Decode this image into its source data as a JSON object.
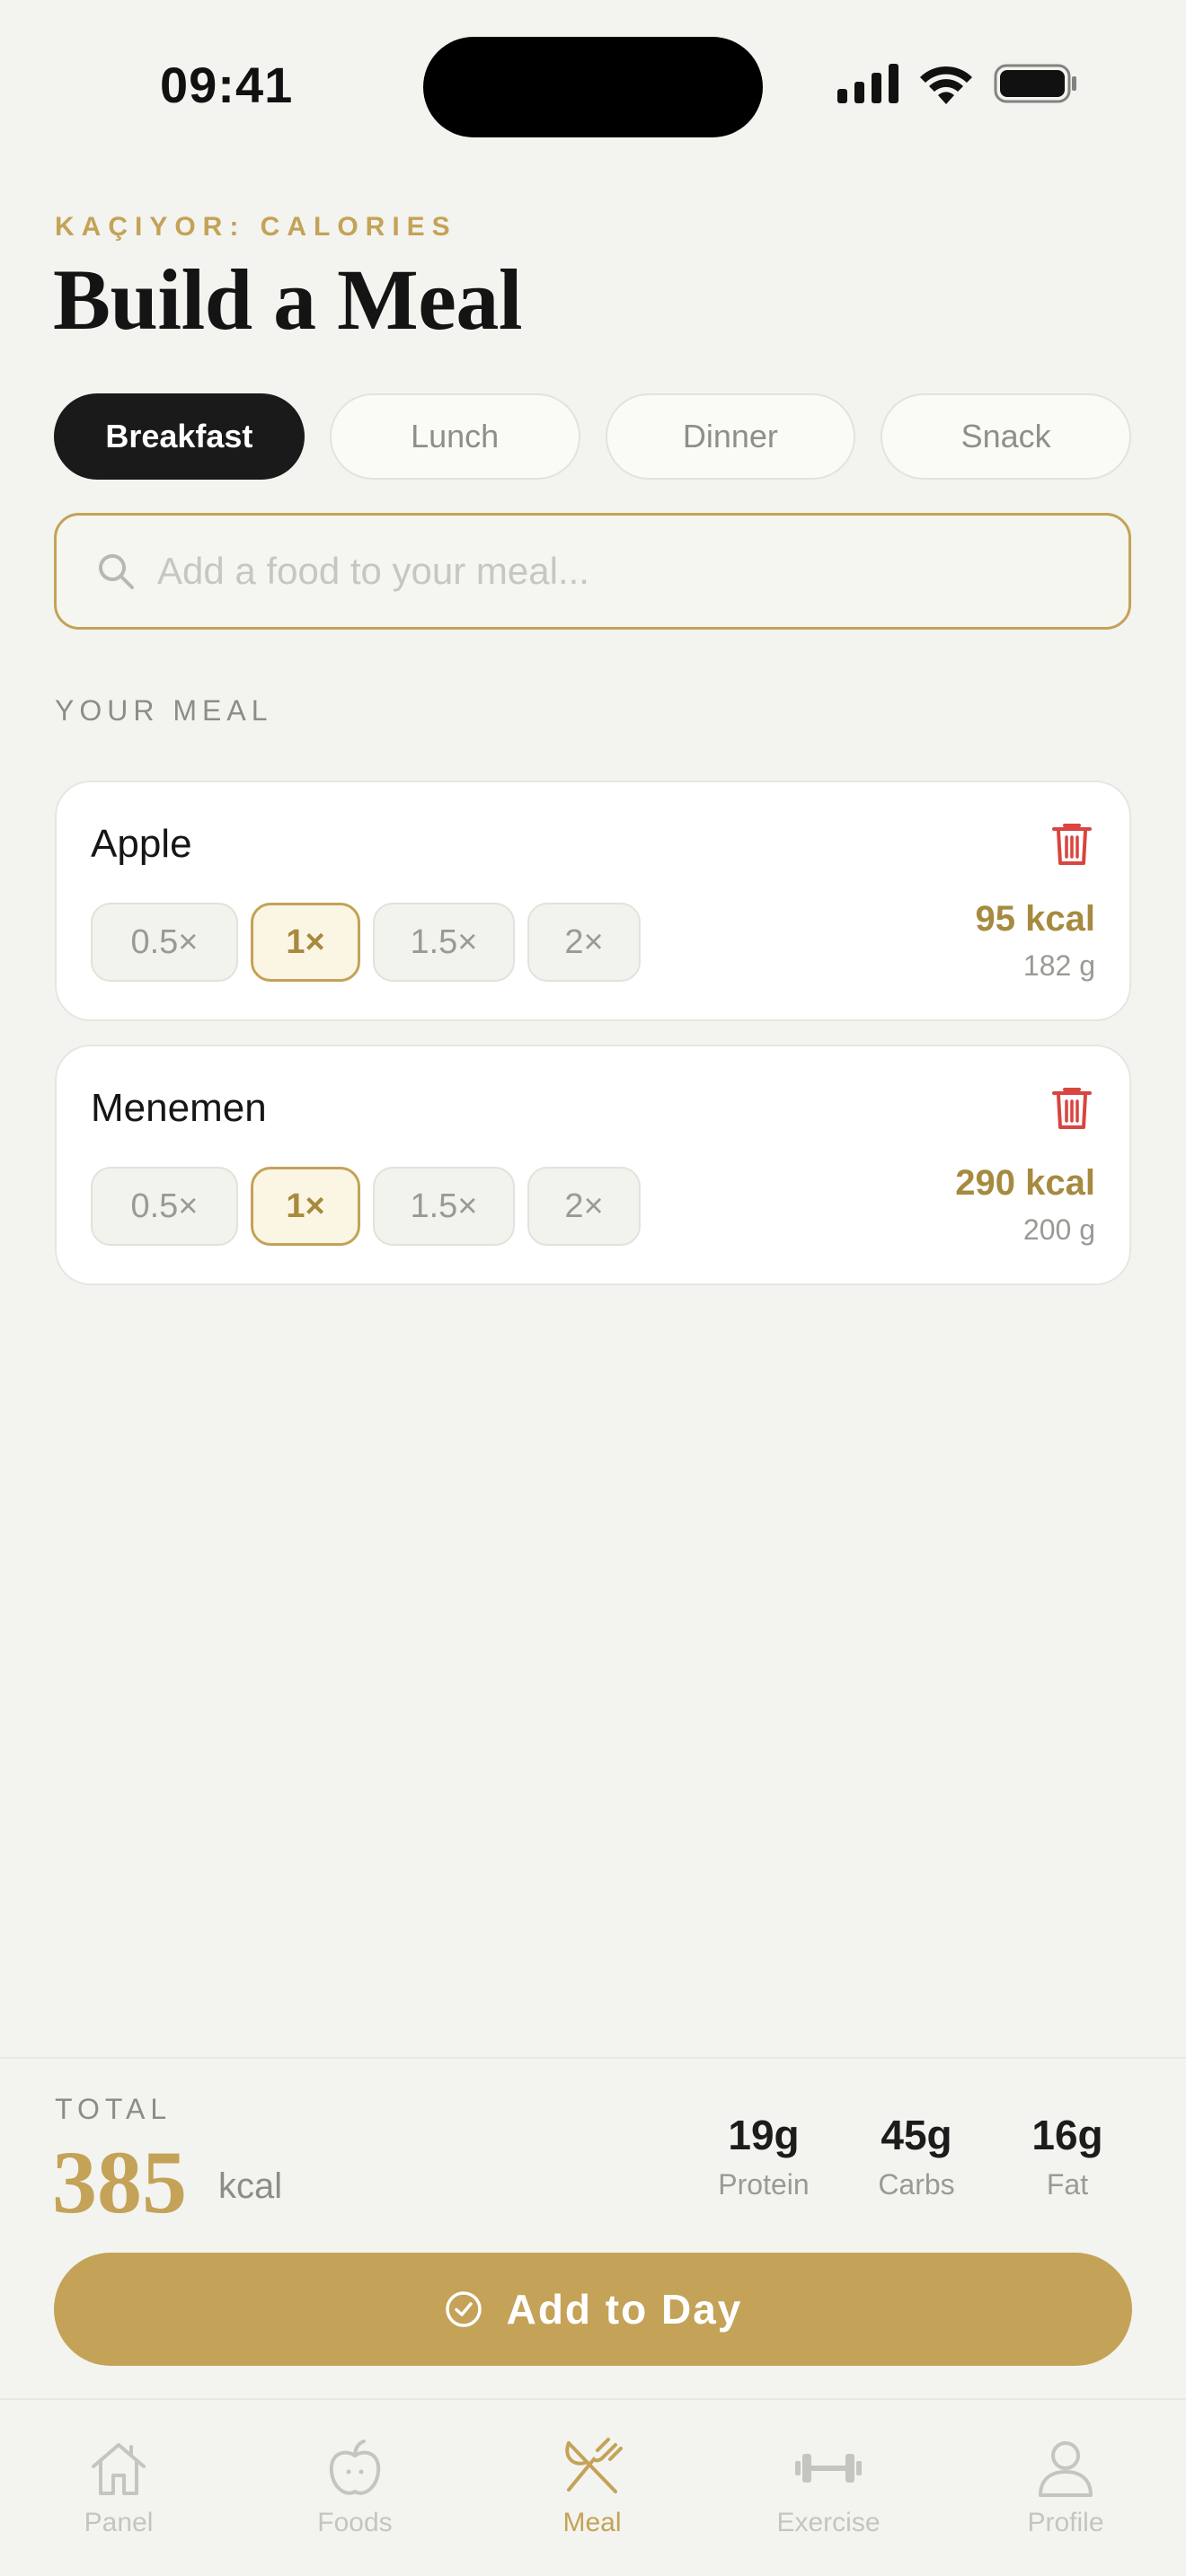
{
  "status": {
    "time": "09:41"
  },
  "header": {
    "eyebrow": "KAÇIYOR: CALORIES",
    "title": "Build a Meal"
  },
  "meal_tabs": [
    {
      "label": "Breakfast",
      "active": true
    },
    {
      "label": "Lunch",
      "active": false
    },
    {
      "label": "Dinner",
      "active": false
    },
    {
      "label": "Snack",
      "active": false
    }
  ],
  "search": {
    "value": "",
    "placeholder": "Add a food to your meal..."
  },
  "section_label": "YOUR MEAL",
  "meal_items": [
    {
      "name": "Apple",
      "multipliers": [
        "0.5×",
        "1×",
        "1.5×",
        "2×"
      ],
      "selected": "1×",
      "kcal": "95 kcal",
      "grams": "182 g"
    },
    {
      "name": "Menemen",
      "multipliers": [
        "0.5×",
        "1×",
        "1.5×",
        "2×"
      ],
      "selected": "1×",
      "kcal": "290 kcal",
      "grams": "200 g"
    }
  ],
  "summary": {
    "total_label": "TOTAL",
    "total_value": "385",
    "total_unit": "kcal",
    "macros": [
      {
        "value": "19g",
        "label": "Protein"
      },
      {
        "value": "45g",
        "label": "Carbs"
      },
      {
        "value": "16g",
        "label": "Fat"
      }
    ]
  },
  "cta": {
    "label": "Add to Day",
    "icon": "check-circle-icon"
  },
  "nav": [
    {
      "label": "Panel",
      "icon": "home-icon",
      "active": false
    },
    {
      "label": "Foods",
      "icon": "apple-icon",
      "active": false
    },
    {
      "label": "Meal",
      "icon": "utensils-icon",
      "active": true
    },
    {
      "label": "Exercise",
      "icon": "dumbbell-icon",
      "active": false
    },
    {
      "label": "Profile",
      "icon": "user-icon",
      "active": false
    }
  ],
  "colors": {
    "accent": "#c4a257",
    "danger": "#d9453f",
    "background": "#f3f4ef",
    "dark": "#1a1a1a"
  }
}
